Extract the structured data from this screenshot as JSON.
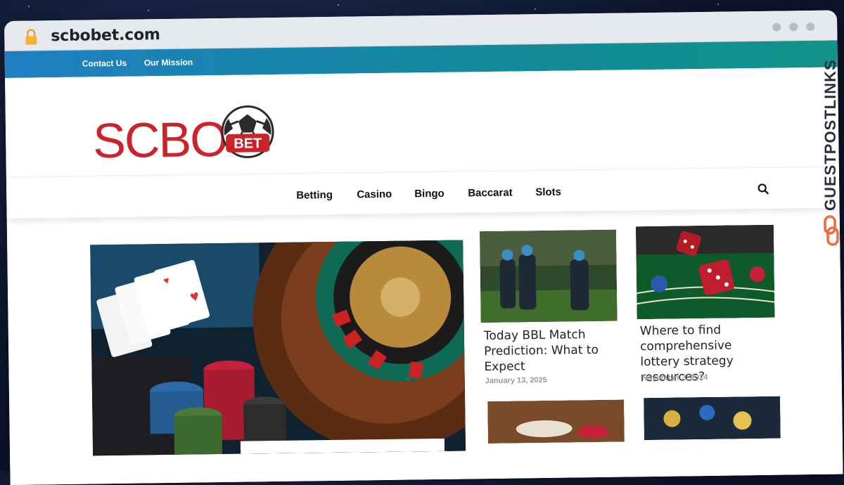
{
  "browser": {
    "url": "scbobet.com"
  },
  "topbar": {
    "links": [
      "Contact Us",
      "Our Mission"
    ]
  },
  "logo": {
    "text": "SCBO",
    "badge": "BET"
  },
  "nav": {
    "items": [
      "Betting",
      "Casino",
      "Bingo",
      "Baccarat",
      "Slots"
    ]
  },
  "posts": [
    {
      "title": "Today BBL Match Prediction: What to Expect",
      "date": "January 13, 2025"
    },
    {
      "title": "Where to find comprehensive lottery strategy resources?",
      "date": "November 3, 2024"
    }
  ],
  "watermark": {
    "text": "GUESTPOSTLINKS"
  },
  "colors": {
    "topbar_start": "#1f7fc2",
    "topbar_end": "#12928a",
    "logo_red": "#cc2229",
    "watermark_orange": "#f26a3d"
  }
}
